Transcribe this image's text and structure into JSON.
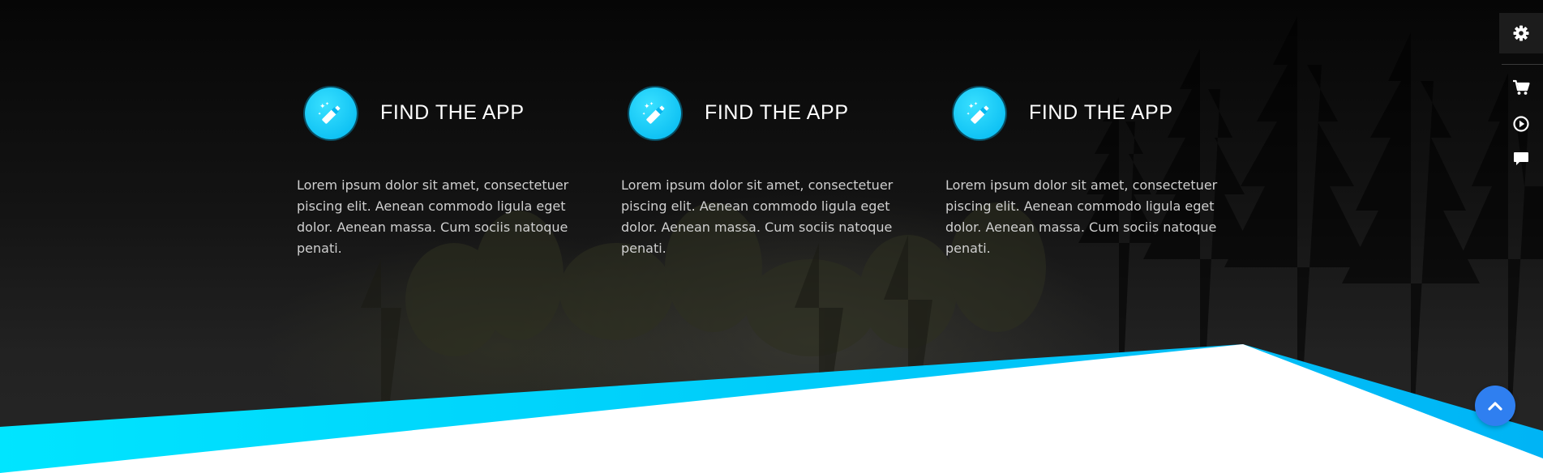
{
  "features": [
    {
      "title": "FIND THE APP",
      "text": "Lorem ipsum dolor sit amet, consectetuer piscing elit. Aenean commodo ligula eget dolor. Aenean massa. Cum sociis natoque penati.",
      "icon": "magic-wand-icon"
    },
    {
      "title": "FIND THE APP",
      "text": "Lorem ipsum dolor sit amet, consectetuer piscing elit. Aenean commodo ligula eget dolor. Aenean massa. Cum sociis natoque penati.",
      "icon": "magic-wand-icon"
    },
    {
      "title": "FIND THE APP",
      "text": "Lorem ipsum dolor sit amet, consectetuer piscing elit. Aenean commodo ligula eget dolor. Aenean massa. Cum sociis natoque penati.",
      "icon": "magic-wand-icon"
    }
  ],
  "side_panel": {
    "buttons": [
      "gear-icon",
      "cart-icon",
      "play-icon",
      "chat-icon"
    ]
  },
  "scroll_top": {
    "icon": "chevron-up-icon"
  },
  "colors": {
    "accent": "#00c2ff",
    "accent_light": "#00e5ff",
    "scroll_button": "#2f7ff0",
    "background": "#0b0b0b",
    "text": "#cfcfcf"
  }
}
